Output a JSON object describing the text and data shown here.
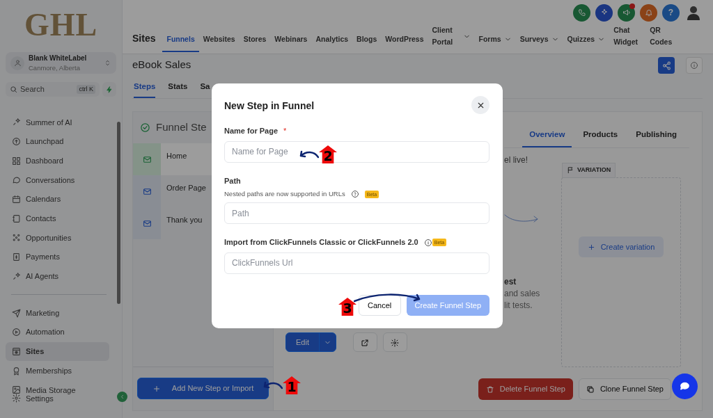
{
  "sidebar": {
    "logo": "GHL",
    "account": {
      "name": "Blank WhiteLabel",
      "location": "Canmore, Alberta"
    },
    "search": {
      "placeholder": "Search",
      "shortcut": "ctrl K"
    },
    "sections": [
      {
        "items": [
          {
            "label": "Summer of AI",
            "selected": false
          },
          {
            "label": "Launchpad",
            "selected": false
          },
          {
            "label": "Dashboard",
            "selected": false
          },
          {
            "label": "Conversations",
            "selected": false
          },
          {
            "label": "Calendars",
            "selected": false
          },
          {
            "label": "Contacts",
            "selected": false
          },
          {
            "label": "Opportunities",
            "selected": false
          },
          {
            "label": "Payments",
            "selected": false
          },
          {
            "label": "AI Agents",
            "selected": false
          }
        ]
      },
      {
        "items": [
          {
            "label": "Marketing",
            "selected": false
          },
          {
            "label": "Automation",
            "selected": false
          },
          {
            "label": "Sites",
            "selected": true
          },
          {
            "label": "Memberships",
            "selected": false
          },
          {
            "label": "Media Storage",
            "selected": false
          },
          {
            "label": "Settings",
            "selected": false
          }
        ]
      }
    ]
  },
  "header": {
    "help_label": "?",
    "announcements": {
      "has_notification": true
    },
    "title": "Sites",
    "tabs": [
      {
        "label": "Funnels",
        "selected": true,
        "dropdown": false
      },
      {
        "label": "Websites",
        "selected": false,
        "dropdown": false
      },
      {
        "label": "Stores",
        "selected": false,
        "dropdown": false
      },
      {
        "label": "Webinars",
        "selected": false,
        "dropdown": false
      },
      {
        "label": "Analytics",
        "selected": false,
        "dropdown": false
      },
      {
        "label": "Blogs",
        "selected": false,
        "dropdown": false
      },
      {
        "label": "WordPress",
        "selected": false,
        "dropdown": false
      },
      {
        "label": "Client Portal",
        "selected": false,
        "dropdown": true
      },
      {
        "label": "Forms",
        "selected": false,
        "dropdown": true
      },
      {
        "label": "Surveys",
        "selected": false,
        "dropdown": true
      },
      {
        "label": "Quizzes",
        "selected": false,
        "dropdown": true
      },
      {
        "label": "Chat Widget",
        "selected": false,
        "dropdown": false
      },
      {
        "label": "QR Codes",
        "selected": false,
        "dropdown": false
      }
    ]
  },
  "funnel": {
    "title": "eBook Sales",
    "tabs": [
      {
        "label": "Steps",
        "selected": true
      },
      {
        "label": "Stats",
        "selected": false
      },
      {
        "label": "Sa",
        "selected": false
      }
    ],
    "steps_panel": {
      "title": "Funnel Ste",
      "steps": [
        {
          "name": "Home",
          "selected": true
        },
        {
          "name": "Order Page",
          "selected": false
        },
        {
          "name": "Thank you",
          "selected": false
        }
      ],
      "add_button": "Add New Step or Import"
    },
    "detail": {
      "tabs": [
        {
          "label": "Overview",
          "selected": true
        },
        {
          "label": "Products",
          "selected": false
        },
        {
          "label": "Publishing",
          "selected": false
        }
      ],
      "notice": "el live!",
      "texts": [
        "est",
        "and sales",
        "lit tests."
      ],
      "variation_tag": "VARIATION",
      "create_variation": "Create variation",
      "edit_button": "Edit",
      "delete_button": "Delete Funnel Step",
      "clone_button": "Clone Funnel Step"
    }
  },
  "modal": {
    "title": "New Step in Funnel",
    "fields": [
      {
        "label": "Name for Page",
        "required": true,
        "placeholder": "Name for Page"
      },
      {
        "label": "Path",
        "required": false,
        "hint": "Nested paths are now supported in URLs",
        "badge": "Beta",
        "placeholder": "Path"
      },
      {
        "label": "Import from ClickFunnels Classic or ClickFunnels 2.0",
        "required": false,
        "badge": "Beta",
        "placeholder": "ClickFunnels Url"
      }
    ],
    "required_mark": "*",
    "cancel_button": "Cancel",
    "submit_button": "Create Funnel Step",
    "submit_disabled": true
  },
  "markers": [
    {
      "number": "1"
    },
    {
      "number": "2"
    },
    {
      "number": "3"
    }
  ]
}
